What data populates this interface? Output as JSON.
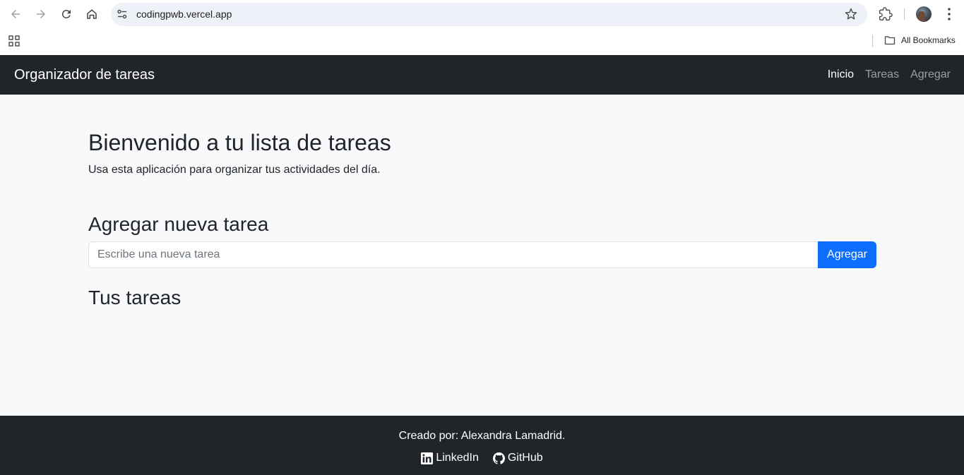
{
  "browser": {
    "url": "codingpwb.vercel.app",
    "bookmarks_label": "All Bookmarks"
  },
  "navbar": {
    "brand": "Organizador de tareas",
    "links": [
      {
        "label": "Inicio",
        "active": true
      },
      {
        "label": "Tareas",
        "active": false
      },
      {
        "label": "Agregar",
        "active": false
      }
    ]
  },
  "hero": {
    "title": "Bienvenido a tu lista de tareas",
    "subtitle": "Usa esta aplicación para organizar tus actividades del día."
  },
  "add_task": {
    "title": "Agregar nueva tarea",
    "placeholder": "Escribe una nueva tarea",
    "value": "",
    "button_label": "Agregar"
  },
  "tasks": {
    "title": "Tus tareas",
    "items": []
  },
  "footer": {
    "credit": "Creado por: Alexandra Lamadrid.",
    "links": [
      {
        "label": "LinkedIn",
        "icon": "linkedin-icon"
      },
      {
        "label": "GitHub",
        "icon": "github-icon"
      }
    ]
  },
  "colors": {
    "navbar_bg": "#212529",
    "page_bg": "#f8f9fa",
    "primary": "#0d6efd"
  }
}
